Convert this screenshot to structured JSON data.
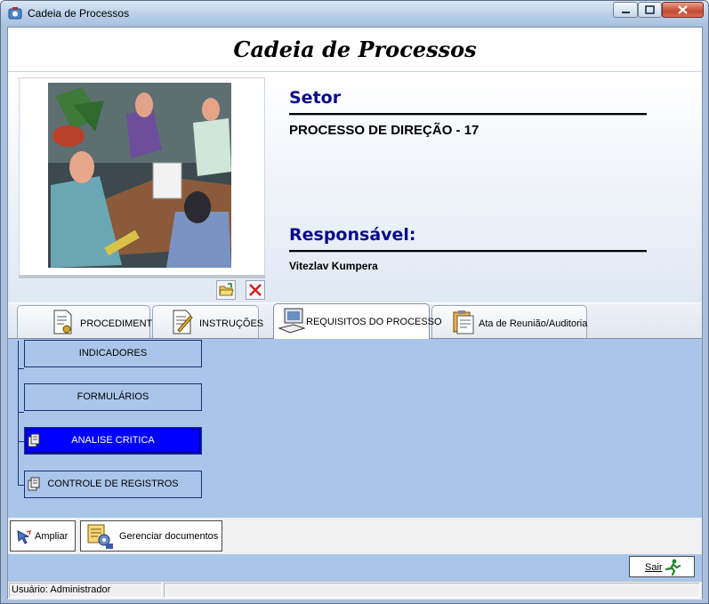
{
  "window": {
    "title": "Cadeia de Processos"
  },
  "header": {
    "title": "Cadeia de Processos"
  },
  "info": {
    "setor_label": "Setor",
    "setor_value": "PROCESSO DE DIREÇÃO - 17",
    "responsavel_label": "Responsável:",
    "responsavel_value": "Vitezlav Kumpera"
  },
  "tabs": [
    {
      "label": "PROCEDIMENTOS",
      "icon": "document-gear-icon",
      "active": false
    },
    {
      "label": "INSTRUÇÕES",
      "icon": "document-pencil-icon",
      "active": false
    },
    {
      "label": "REQUISITOS DO PROCESSO",
      "icon": "computer-icon",
      "active": true
    },
    {
      "label": "Ata de Reunião/Auditoria",
      "icon": "clipboard-icon",
      "active": false
    }
  ],
  "tree": {
    "nodes": [
      {
        "label": "INDICADORES",
        "selected": false,
        "has_icon": false
      },
      {
        "label": "FORMULÁRIOS",
        "selected": false,
        "has_icon": false
      },
      {
        "label": "ANALISE CRITICA",
        "selected": true,
        "has_icon": true
      },
      {
        "label": "CONTROLE DE REGISTROS",
        "selected": false,
        "has_icon": true
      }
    ]
  },
  "toolbar": {
    "ampliar_label": "Ampliar",
    "gerenciar_label": "Gerenciar documentos"
  },
  "bottom": {
    "sair_label": "Sair"
  },
  "status": {
    "user": "Usuário: Administrador"
  },
  "colors": {
    "accent_blue": "#0a0a8a",
    "selected_node": "#0000ff",
    "panel_bg": "#a9c6ea"
  }
}
